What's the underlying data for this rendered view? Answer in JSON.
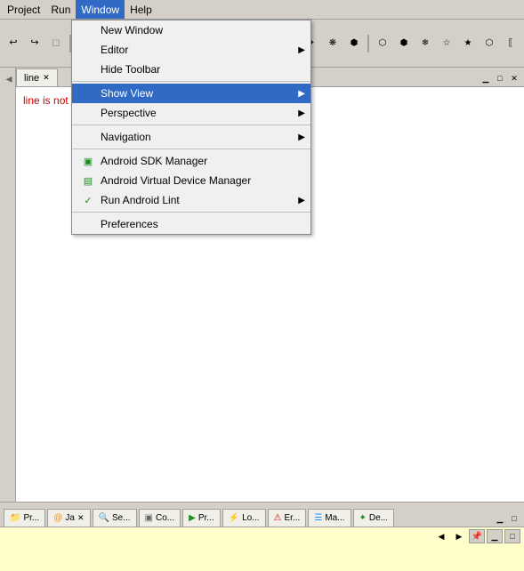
{
  "menubar": {
    "items": [
      {
        "label": "Project",
        "id": "project"
      },
      {
        "label": "Run",
        "id": "run"
      },
      {
        "label": "Window",
        "id": "window",
        "active": true
      },
      {
        "label": "Help",
        "id": "help"
      }
    ]
  },
  "window_menu": {
    "items": [
      {
        "id": "new-window",
        "label": "New Window",
        "has_arrow": false,
        "icon": null
      },
      {
        "id": "editor",
        "label": "Editor",
        "has_arrow": true,
        "icon": null
      },
      {
        "id": "hide-toolbar",
        "label": "Hide Toolbar",
        "has_arrow": false,
        "icon": null
      },
      {
        "id": "separator1",
        "type": "separator"
      },
      {
        "id": "show-view",
        "label": "Show View",
        "has_arrow": true,
        "icon": null,
        "highlighted": true
      },
      {
        "id": "perspective",
        "label": "Perspective",
        "has_arrow": true,
        "icon": null
      },
      {
        "id": "separator2",
        "type": "separator"
      },
      {
        "id": "navigation",
        "label": "Navigation",
        "has_arrow": true,
        "icon": null
      },
      {
        "id": "separator3",
        "type": "separator"
      },
      {
        "id": "android-sdk-manager",
        "label": "Android SDK Manager",
        "has_arrow": false,
        "icon": "android"
      },
      {
        "id": "android-virtual",
        "label": "Android Virtual Device Manager",
        "has_arrow": false,
        "icon": "android2"
      },
      {
        "id": "run-android-lint",
        "label": "Run Android Lint",
        "has_arrow": true,
        "icon": "check"
      },
      {
        "id": "separator4",
        "type": "separator"
      },
      {
        "id": "preferences",
        "label": "Preferences",
        "has_arrow": false,
        "icon": null
      }
    ]
  },
  "editor": {
    "tab_label": "line",
    "tab_id": "line",
    "content": "line is not available.",
    "tab_actions": [
      "minimize",
      "maximize",
      "close"
    ]
  },
  "bottom_tabs": [
    {
      "id": "pr1",
      "label": "Pr...",
      "icon": "folder",
      "closable": false
    },
    {
      "id": "ja",
      "label": "Ja",
      "icon": "java",
      "closable": true
    },
    {
      "id": "se",
      "label": "Se...",
      "icon": "search",
      "closable": false
    },
    {
      "id": "co",
      "label": "Co...",
      "icon": "console",
      "closable": false
    },
    {
      "id": "pr2",
      "label": "Pr...",
      "icon": "progress",
      "closable": false
    },
    {
      "id": "lo",
      "label": "Lo...",
      "icon": "log",
      "closable": false
    },
    {
      "id": "er",
      "label": "Er...",
      "icon": "error",
      "closable": false
    },
    {
      "id": "ma",
      "label": "Ma...",
      "icon": "map",
      "closable": false
    },
    {
      "id": "de",
      "label": "De...",
      "icon": "device",
      "closable": false
    }
  ],
  "bottom_panel_controls": {
    "nav_back": "◀",
    "nav_forward": "▶",
    "pin": "📌",
    "minimize": "▁",
    "maximize": "□"
  },
  "colors": {
    "accent": "#316ac5",
    "background": "#d4d0c8",
    "menu_bg": "#f0f0f0",
    "editor_bg": "#ffffff",
    "bottom_panel_bg": "#ffffcc"
  }
}
